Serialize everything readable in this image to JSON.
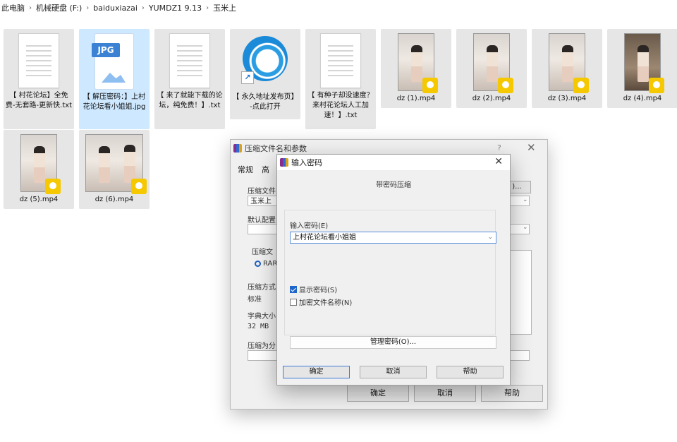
{
  "breadcrumb": [
    "此电脑",
    "机械硬盘 (F:)",
    "baiduxiazai",
    "YUMDZ1  9.13",
    "玉米上"
  ],
  "files": [
    {
      "label": "【 村花论坛】全免费-无套路-更新快.txt",
      "type": "txt"
    },
    {
      "label": "【 解压密码：】上村花论坛看小姐姐.jpg",
      "type": "jpg",
      "icon_text": "JPG"
    },
    {
      "label": "【 来了就能下载的论坛，纯免费！】.txt",
      "type": "txt"
    },
    {
      "label": "【 永久地址发布页】-点此打开",
      "type": "url"
    },
    {
      "label": "【 有种子却没速度？来村花论坛人工加速！】.txt",
      "type": "txt"
    },
    {
      "label": "dz (1).mp4",
      "type": "mp4"
    },
    {
      "label": "dz (2).mp4",
      "type": "mp4"
    },
    {
      "label": "dz (3).mp4",
      "type": "mp4"
    },
    {
      "label": "dz (4).mp4",
      "type": "mp4"
    },
    {
      "label": "dz (5).mp4",
      "type": "mp4"
    },
    {
      "label": "dz (6).mp4",
      "type": "mp4"
    }
  ],
  "archive_dialog": {
    "title": "压缩文件名和参数",
    "help_glyph": "?",
    "close_glyph": "✕",
    "tabs": [
      "常规",
      "高"
    ],
    "name_label": "压缩文件",
    "name_value": "玉米上",
    "browse_label": ")...",
    "profile_label": "默认配置",
    "format_label": "压缩文",
    "format_value": "RAR",
    "method_label": "压缩方式",
    "method_value": "标准",
    "dict_label": "字典大小",
    "dict_value": "32 MB",
    "split_label": "压缩为分",
    "ok_label": "确定",
    "cancel_label": "取消",
    "help_label": "帮助"
  },
  "password_dialog": {
    "title": "输入密码",
    "caption": "带密码压缩",
    "password_label": "输入密码(E)",
    "password_value": "上村花论坛看小姐姐",
    "show_password_label": "显示密码(S)",
    "show_password_checked": true,
    "encrypt_names_label": "加密文件名称(N)",
    "encrypt_names_checked": false,
    "manage_label": "管理密码(O)...",
    "ok_label": "确定",
    "cancel_label": "取消",
    "help_label": "帮助",
    "close_glyph": "✕"
  },
  "colors": {
    "selected_tile": "#cde8ff",
    "tile": "#e6e6e6",
    "accent": "#1f66c9",
    "play_badge": "#f5c800"
  }
}
